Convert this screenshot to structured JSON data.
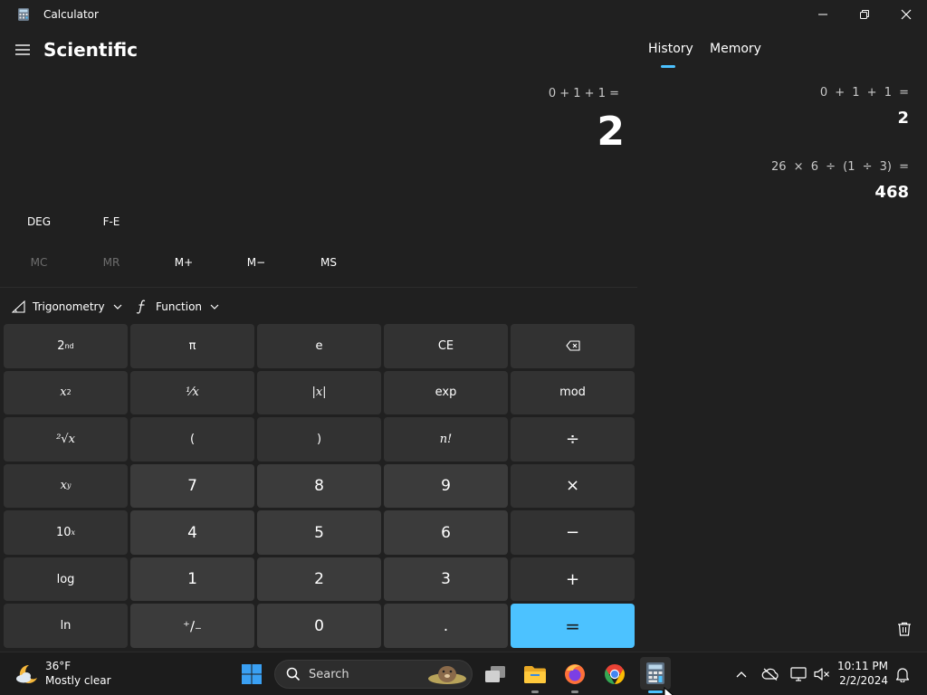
{
  "window": {
    "title": "Calculator"
  },
  "header": {
    "mode": "Scientific"
  },
  "display": {
    "expression": "0 + 1 + 1 =",
    "result": "2"
  },
  "mode_row": {
    "angle": "DEG",
    "notation": "F-E"
  },
  "memory": {
    "mc": "MC",
    "mr": "MR",
    "m_plus": "M+",
    "m_minus": "M−",
    "ms": "MS"
  },
  "dropdowns": {
    "trigonometry": "Trigonometry",
    "function": "Function"
  },
  "keys": {
    "second": "2",
    "second_sup": "nd",
    "pi": "π",
    "e": "e",
    "ce": "CE",
    "x_squared_base": "x",
    "x_squared_sup": "2",
    "reciprocal": "¹⁄x",
    "abs": "|x|",
    "exp": "exp",
    "mod": "mod",
    "sqrt": "²√x",
    "open_paren": "(",
    "close_paren": ")",
    "factorial": "n!",
    "divide": "÷",
    "x_power_base": "x",
    "x_power_sup": "y",
    "seven": "7",
    "eight": "8",
    "nine": "9",
    "multiply": "×",
    "ten_power_base": "10",
    "ten_power_sup": "x",
    "four": "4",
    "five": "5",
    "six": "6",
    "minus": "−",
    "log": "log",
    "one": "1",
    "two": "2",
    "three": "3",
    "plus": "+",
    "ln": "ln",
    "negate": "⁺∕₋",
    "zero": "0",
    "decimal": ".",
    "equals": "="
  },
  "panel": {
    "tab_history": "History",
    "tab_memory": "Memory",
    "history": [
      {
        "expression": "0 + 1 + 1 =",
        "result": "2"
      },
      {
        "expression": "26 × 6 ÷ (1 ÷ 3) =",
        "result": "468"
      }
    ]
  },
  "taskbar": {
    "weather_temp": "36°F",
    "weather_desc": "Mostly clear",
    "search_label": "Search",
    "time": "10:11 PM",
    "date": "2/2/2024"
  },
  "colors": {
    "accent": "#4cc2ff",
    "background": "#202020",
    "key": "#323232",
    "number_key": "#3b3b3b"
  }
}
